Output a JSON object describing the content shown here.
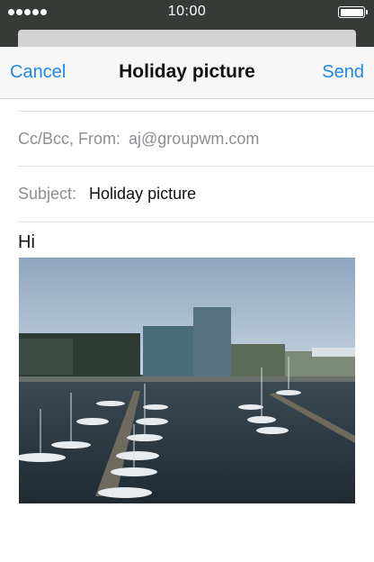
{
  "status_bar": {
    "time": "10:00",
    "signal_dots": 5
  },
  "navbar": {
    "cancel_label": "Cancel",
    "title": "Holiday picture",
    "send_label": "Send"
  },
  "compose": {
    "cc_bcc_from_label": "Cc/Bcc, From:",
    "from_email": "aj@groupwm.com",
    "subject_label": "Subject:",
    "subject_value": "Holiday picture",
    "body_text": "Hi"
  },
  "colors": {
    "accent": "#1e88e5",
    "status_bar_bg": "#363b37",
    "muted_text": "#8e8e93"
  }
}
